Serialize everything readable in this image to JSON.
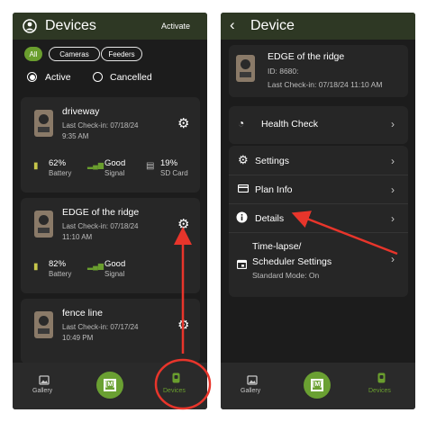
{
  "left": {
    "header": {
      "title": "Devices",
      "activate": "Activate"
    },
    "filters": [
      "All",
      "Cameras",
      "Feeders"
    ],
    "status": {
      "active": "Active",
      "cancelled": "Cancelled"
    },
    "cards": [
      {
        "name": "driveway",
        "checkin_line1": "Last Check-in: 07/18/24",
        "checkin_line2": "9:35 AM",
        "battery_value": "62%",
        "battery_label": "Battery",
        "signal_value": "Good",
        "signal_label": "Signal",
        "sd_value": "19%",
        "sd_label": "SD Card"
      },
      {
        "name": "EDGE of the ridge",
        "checkin_line1": "Last Check-in: 07/18/24",
        "checkin_line2": "11:10 AM",
        "battery_value": "82%",
        "battery_label": "Battery",
        "signal_value": "Good",
        "signal_label": "Signal"
      },
      {
        "name": "fence line",
        "checkin_line1": "Last Check-in: 07/17/24",
        "checkin_line2": "10:49 PM"
      }
    ],
    "nav": {
      "gallery": "Gallery",
      "center_logo": "[M]",
      "devices": "Devices"
    }
  },
  "right": {
    "header": {
      "title": "Device"
    },
    "device": {
      "name": "EDGE of the ridge",
      "id": "ID: 8680:",
      "checkin": "Last Check-in: 07/18/24 11:10 AM"
    },
    "menu": {
      "health_check": "Health Check",
      "settings": "Settings",
      "plan_info": "Plan Info",
      "details": "Details",
      "timelapse_line1": "Time-lapse/",
      "timelapse_line2": "Scheduler Settings",
      "standard_mode": "Standard Mode: On"
    },
    "nav": {
      "gallery": "Gallery",
      "center_logo": "[M]",
      "devices": "Devices"
    }
  },
  "colors": {
    "header_bg": "#2e3824",
    "accent_green": "#6a9e2e",
    "annotation_red": "#e8352b"
  }
}
